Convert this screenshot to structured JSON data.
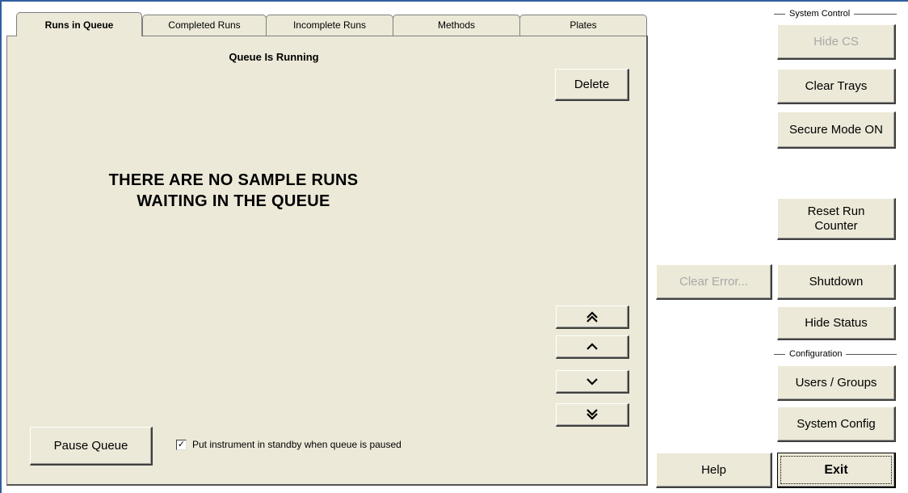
{
  "tabs": [
    {
      "label": "Runs in Queue",
      "active": true
    },
    {
      "label": "Completed Runs",
      "active": false
    },
    {
      "label": "Incomplete Runs",
      "active": false
    },
    {
      "label": "Methods",
      "active": false
    },
    {
      "label": "Plates",
      "active": false
    }
  ],
  "queue": {
    "status": "Queue Is Running",
    "empty_message": "THERE ARE NO SAMPLE RUNS\nWAITING  IN THE QUEUE",
    "delete_label": "Delete",
    "move_top_icon": "double-chevron-up",
    "move_up_icon": "chevron-up",
    "move_down_icon": "chevron-down",
    "move_bottom_icon": "double-chevron-down",
    "pause_label": "Pause Queue",
    "standby_checkbox": {
      "label": "Put instrument in standby when queue is paused",
      "checked": true
    }
  },
  "system_control": {
    "header": "System Control",
    "hide_cs_label": "Hide CS",
    "clear_trays_label": "Clear Trays",
    "secure_mode_label": "Secure Mode ON",
    "reset_counter_label": "Reset Run\nCounter",
    "shutdown_label": "Shutdown",
    "hide_status_label": "Hide Status"
  },
  "configuration": {
    "header": "Configuration",
    "users_groups_label": "Users / Groups",
    "system_config_label": "System Config"
  },
  "bottom": {
    "clear_error_label": "Clear Error...",
    "help_label": "Help",
    "exit_label": "Exit"
  },
  "colors": {
    "face": "#ece9d8",
    "disabled_text": "#a8a8a8",
    "frame": "#2f5f9f"
  }
}
